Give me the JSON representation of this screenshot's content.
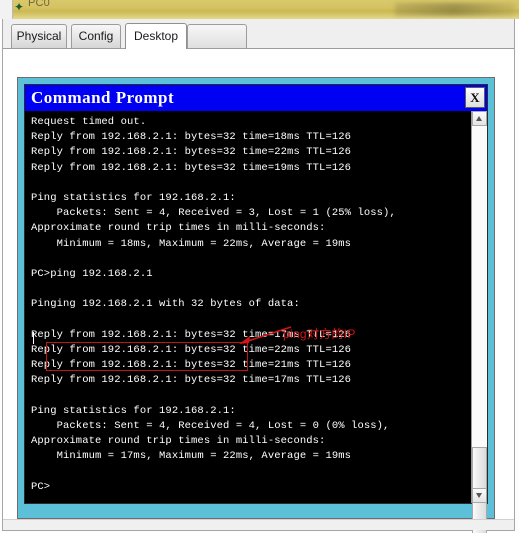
{
  "window": {
    "title": "PC0",
    "icon": "pc-device-icon"
  },
  "tabs": [
    {
      "label": "Physical",
      "active": false
    },
    {
      "label": "Config",
      "active": false
    },
    {
      "label": "Desktop",
      "active": true
    }
  ],
  "terminal": {
    "title": "Command Prompt",
    "close_label": "X",
    "prompt": "PC>",
    "target_ip": "192.168.2.1",
    "lines": [
      "Request timed out.",
      "Reply from 192.168.2.1: bytes=32 time=18ms TTL=126",
      "Reply from 192.168.2.1: bytes=32 time=22ms TTL=126",
      "Reply from 192.168.2.1: bytes=32 time=19ms TTL=126",
      "",
      "Ping statistics for 192.168.2.1:",
      "    Packets: Sent = 4, Received = 3, Lost = 1 (25% loss),",
      "Approximate round trip times in milli-seconds:",
      "    Minimum = 18ms, Maximum = 22ms, Average = 19ms",
      "",
      "PC>ping 192.168.2.1",
      "",
      "Pinging 192.168.2.1 with 32 bytes of data:",
      "",
      "Reply from 192.168.2.1: bytes=32 time=17ms TTL=126",
      "Reply from 192.168.2.1: bytes=32 time=22ms TTL=126",
      "Reply from 192.168.2.1: bytes=32 time=21ms TTL=126",
      "Reply from 192.168.2.1: bytes=32 time=17ms TTL=126",
      "",
      "Ping statistics for 192.168.2.1:",
      "    Packets: Sent = 4, Received = 4, Lost = 0 (0% loss),",
      "Approximate round trip times in milli-seconds:",
      "    Minimum = 17ms, Maximum = 22ms, Average = 19ms",
      "",
      "PC>"
    ]
  },
  "annotation": {
    "text": "ping对方的IP",
    "color": "#d61414",
    "highlighted_command": "PC>ping 192.168.2.1"
  },
  "colors": {
    "titlebar_gold": "#d4c263",
    "terminal_frame_cyan": "#5cc0d8",
    "cmd_titlebar_blue": "#0000f2",
    "terminal_bg": "#000000",
    "terminal_fg": "#ffffff",
    "annotation_red": "#d61414"
  },
  "scrollbar": {
    "up_arrow": "scroll-up-arrow-icon",
    "down_arrow": "scroll-down-arrow-icon"
  }
}
